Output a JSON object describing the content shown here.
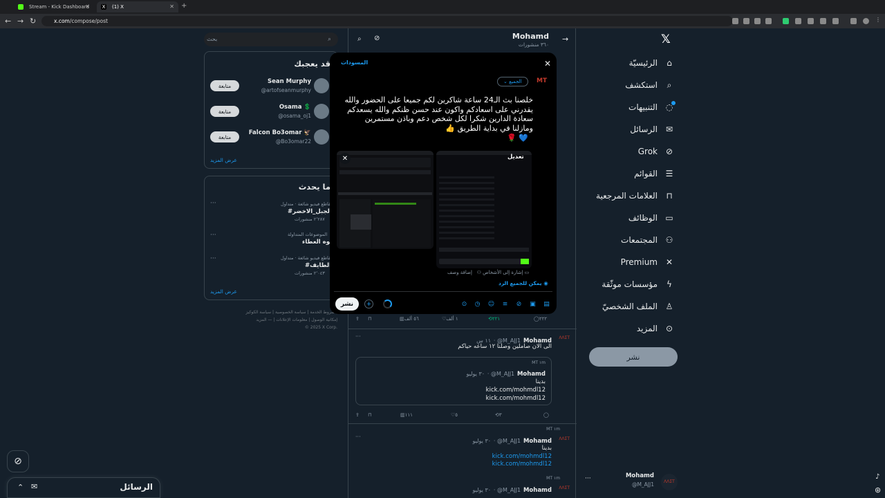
{
  "browser": {
    "tabs": [
      {
        "title": "Stream - Kick Dashboard",
        "favicon_color": "#53fc18"
      },
      {
        "title": "(1) X"
      }
    ],
    "url_host": "x.com",
    "url_path": "/compose/post"
  },
  "sidebar": {
    "logo": "𝕏",
    "items": [
      {
        "label": "الرئيسيّة",
        "icon": "home-icon"
      },
      {
        "label": "استكشف",
        "icon": "search-icon"
      },
      {
        "label": "التنبيهات",
        "icon": "bell-icon"
      },
      {
        "label": "الرسائل",
        "icon": "mail-icon"
      },
      {
        "label": "Grok",
        "icon": "grok-icon"
      },
      {
        "label": "القوائم",
        "icon": "list-icon"
      },
      {
        "label": "العلامات المرجعية",
        "icon": "bookmark-icon"
      },
      {
        "label": "الوظائف",
        "icon": "briefcase-icon"
      },
      {
        "label": "المجتمعات",
        "icon": "people-icon"
      },
      {
        "label": "Premium",
        "icon": "x-icon"
      },
      {
        "label": "مؤسسات موثّقة",
        "icon": "bolt-icon"
      },
      {
        "label": "الملف الشخصيّ",
        "icon": "person-icon"
      },
      {
        "label": "المزيد",
        "icon": "more-circle-icon"
      }
    ],
    "post_button": "نشر",
    "account": {
      "name": "Mohamd",
      "handle": "@M_AJJ1"
    }
  },
  "profile_header": {
    "name": "Mohamd",
    "subtitle": "٣٦٠ منشورات"
  },
  "timeline": {
    "actions_row1": {
      "replies": "٢٢٢",
      "reposts": "٢٢١",
      "likes": "١ ألف",
      "views": "٥٦ ألف"
    },
    "tweet1": {
      "name": "Mohamd",
      "handle": "@M_AJJ1",
      "time": "١١ س",
      "text": "الى الان صاملين وصلنا ١٢ ساعه حياكم"
    },
    "quote1": {
      "meta": "MT ١m",
      "name": "Mohamd",
      "handle": "@M_AJJ1",
      "date": "٣٠ يوليو",
      "line1": "بدينا",
      "line2": "kick.com/mohmdl12",
      "line3": "kick.com/mohmdl12"
    },
    "actions_row2": {
      "reposts": "٣",
      "likes": "٥",
      "views": "١١١"
    },
    "tweet2": {
      "meta": "MT ١m",
      "name": "Mohamd",
      "handle": "@M_AJJ1",
      "date": "٣٠ يوليو",
      "line1": "بدينا",
      "line2": "kick.com/mohmdl12",
      "line3": "kick.com/mohmdl12"
    },
    "tweet3": {
      "meta": "MT ١m",
      "name": "Mohamd",
      "handle": "@M_AJJ1",
      "date": "٣٠ يوليو"
    }
  },
  "right": {
    "search_placeholder": "بحث",
    "who_to_follow": {
      "title": "قد يعجبك",
      "users": [
        {
          "name": "Sean Murphy",
          "handle": "@artofseanmurphy",
          "button": "متابعة"
        },
        {
          "name": "Osama 💲",
          "handle": "@osama_oj1",
          "button": "متابعة"
        },
        {
          "name": "Falcon Bo3omar 🦅",
          "handle": "@Bo3omar22",
          "button": "متابعة"
        }
      ],
      "show_more": "عرض المزيد"
    },
    "trends": {
      "title": "ما يحدث",
      "items": [
        {
          "category": "مقاطع فيديو شائعة · متداول",
          "name": "#الجبل_الاخضر",
          "count": "٢٬٢٨٧ منشورات"
        },
        {
          "category": "الموضوعات المتداولة",
          "name": "كوه العطاء",
          "count": ""
        },
        {
          "category": "مقاطع فيديو شائعة · متداول",
          "name": "#الطايف",
          "count": "٢٬٠٤٣ منشورات"
        }
      ],
      "show_more": "عرض المزيد"
    },
    "footer": [
      "شروط الخدمة | سياسة الخصوصية | سياسة الكوكيز |",
      "إمكانية الوصول | معلومات الإعلانات | — المزيد",
      "© 2025 X Corp."
    ]
  },
  "compose_modal": {
    "drafts": "المسودات",
    "audience": "الجميع",
    "text": "خلصنا بث الـ24 ساعة شاكرين لكم جميعا على الحضور والله يقدرني على اسعادكم واكون عند حسن ظنكم والله يسعدكم سعادة الدارين شكرا لكل شخص دعم وباذن مستمرين ومازلنا في بداية الطريق 👍",
    "emoji_line": "🌹 💙",
    "edit_label": "تعديل",
    "tag_people": "إشارة إلى الأشخاص",
    "add_description": "إضافة وصف",
    "reply_setting": "يمكن للجميع الرد",
    "post_button": "نشر"
  },
  "dm_drawer": {
    "title": "الرسائل"
  },
  "colors": {
    "accent": "#1d9bf0",
    "background": "#15202b",
    "modal": "#000000"
  }
}
